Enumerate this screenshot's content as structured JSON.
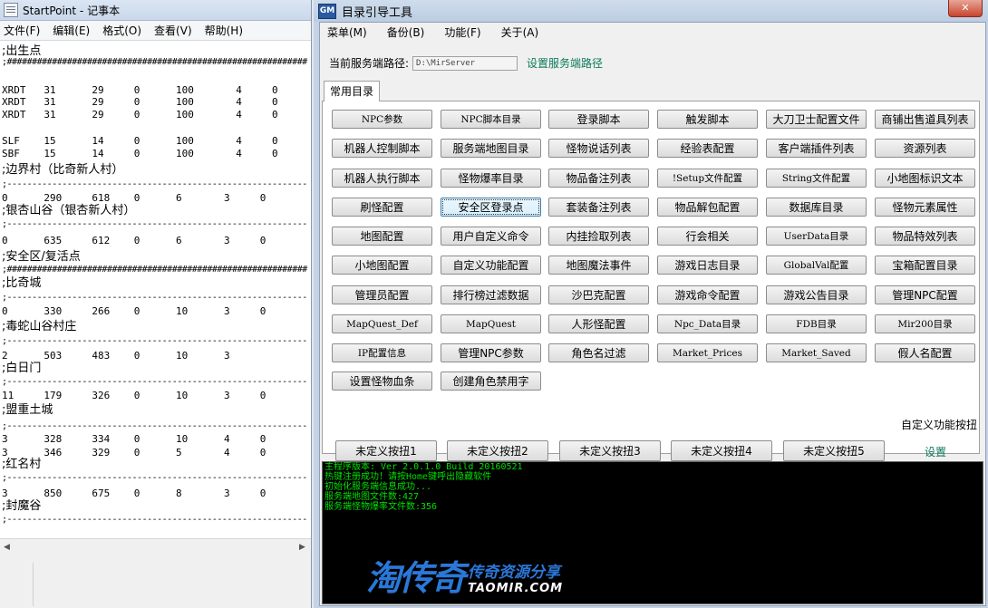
{
  "notepad": {
    "title": "StartPoint - 记事本",
    "menu": [
      "文件(F)",
      "编辑(E)",
      "格式(O)",
      "查看(V)",
      "帮助(H)"
    ],
    "lines": [
      ";出生点",
      ";############################################################",
      "",
      "XRDT   31      29     0      100       4     0",
      "XRDT   31      29     0      100       4     0",
      "XRDT   31      29     0      100       4     0",
      "",
      "SLF    15      14     0      100       4     0",
      "SBF    15      14     0      100       4     0",
      ";边界村（比奇新人村）",
      ";------------------------------------------------------------",
      "0      290     618    0      6       3     0",
      ";银杏山谷（银杏新人村）",
      ";------------------------------------------------------------",
      "0      635     612    0      6       3     0",
      ";安全区/复活点",
      ";############################################################",
      ";比奇城",
      ";------------------------------------------------------------",
      "0      330     266    0      10      3     0",
      ";毒蛇山谷村庄",
      ";------------------------------------------------------------",
      "2      503     483    0      10      3",
      ";白日门",
      ";------------------------------------------------------------",
      "11     179     326    0      10      3     0",
      ";盟重土城",
      ";------------------------------------------------------------",
      "3      328     334    0      10      4     0",
      "3      346     329    0      5       4     0",
      ";红名村",
      ";------------------------------------------------------------",
      "3      850     675    0      8       3     0",
      ";封魔谷",
      ";------------------------------------------------------------"
    ]
  },
  "tool": {
    "logo": "GM",
    "title": "目录引导工具",
    "close": "✕",
    "menu": [
      "菜单(M)",
      "备份(B)",
      "功能(F)",
      "关于(A)"
    ],
    "path_label": "当前服务端路径:",
    "path_value": "D:\\MirServer",
    "path_link": "设置服务端路径",
    "tab": "常用目录",
    "buttons": [
      [
        "NPC参数",
        "NPC脚本目录",
        "登录脚本",
        "触发脚本",
        "大刀卫士配置文件",
        "商铺出售道具列表"
      ],
      [
        "机器人控制脚本",
        "服务端地图目录",
        "怪物说话列表",
        "经验表配置",
        "客户端插件列表",
        "资源列表"
      ],
      [
        "机器人执行脚本",
        "怪物爆率目录",
        "物品备注列表",
        "!Setup文件配置",
        "String文件配置",
        "小地图标识文本"
      ],
      [
        "刷怪配置",
        "安全区登录点",
        "套装备注列表",
        "物品解包配置",
        "数据库目录",
        "怪物元素属性"
      ],
      [
        "地图配置",
        "用户自定义命令",
        "内挂捡取列表",
        "行会相关",
        "UserData目录",
        "物品特效列表"
      ],
      [
        "小地图配置",
        "自定义功能配置",
        "地图魔法事件",
        "游戏日志目录",
        "GlobalVal配置",
        "宝箱配置目录"
      ],
      [
        "管理员配置",
        "排行榜过滤数据",
        "沙巴克配置",
        "游戏命令配置",
        "游戏公告目录",
        "管理NPC配置"
      ],
      [
        "MapQuest_Def",
        "MapQuest",
        "人形怪配置",
        "Npc_Data目录",
        "FDB目录",
        "Mir200目录"
      ],
      [
        "IP配置信息",
        "管理NPC参数",
        "角色名过滤",
        "Market_Prices",
        "Market_Saved",
        "假人名配置"
      ],
      [
        "设置怪物血条",
        "创建角色禁用字"
      ]
    ],
    "custom_label": "自定义功能按扭",
    "custom_buttons": [
      "未定义按扭1",
      "未定义按扭2",
      "未定义按扭3",
      "未定义按扭4",
      "未定义按扭5"
    ],
    "settings_link": "设置",
    "console": [
      "主程序版本: Ver 2.0.1.0 Build 20160521",
      "热键注册成功！请按Home键呼出隐藏软件",
      "初始化服务端信息成功...",
      "服务端地图文件数:427",
      "服务端怪物爆率文件数:356"
    ],
    "watermark": {
      "big": "淘传奇",
      "cn": "传奇资源分享",
      "en": "TAOMIR.COM"
    }
  }
}
